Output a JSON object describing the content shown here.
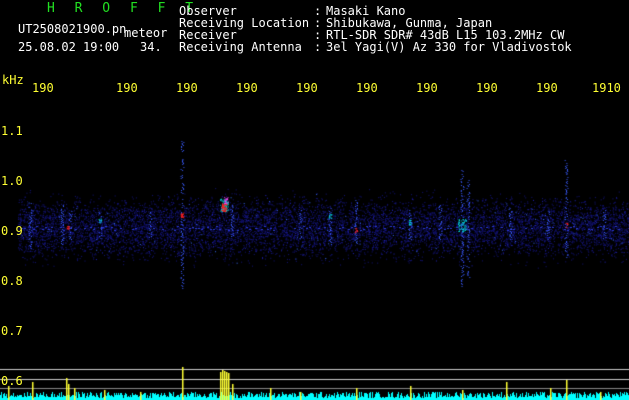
{
  "header": {
    "program": "H R O F F T",
    "filename": "UT2508021900.pn",
    "mode": "meteor",
    "datetime": "25.08.02 19:00",
    "count": "34.",
    "fields": [
      {
        "key": "Observer",
        "value": "Masaki Kano"
      },
      {
        "key": "Receiving Location",
        "value": "Shibukawa, Gunma, Japan"
      },
      {
        "key": "Receiver",
        "value": "RTL-SDR SDR# 43dB L15 103.2MHz CW"
      },
      {
        "key": "Receiving Antenna",
        "value": "3el Yagi(V) Az 330 for Vladivostok"
      }
    ]
  },
  "axes": {
    "y_unit": "kHz",
    "y_ticks": [
      "1.1",
      "1.0",
      "0.9",
      "0.8",
      "0.7",
      "0.6"
    ],
    "x_ticks": [
      "190",
      "190",
      "190",
      "190",
      "190",
      "190",
      "190",
      "190",
      "190",
      "1910"
    ]
  },
  "colors": {
    "background": "#000000",
    "noise": "#1a1aa0",
    "signal_strong": "#ff2020",
    "signal_mid": "#00e0e0",
    "trace": "#00ffff",
    "spike": "#ffff33",
    "text_header": "#ffffff",
    "text_axis": "#ffff33",
    "title": "#22e022"
  }
}
